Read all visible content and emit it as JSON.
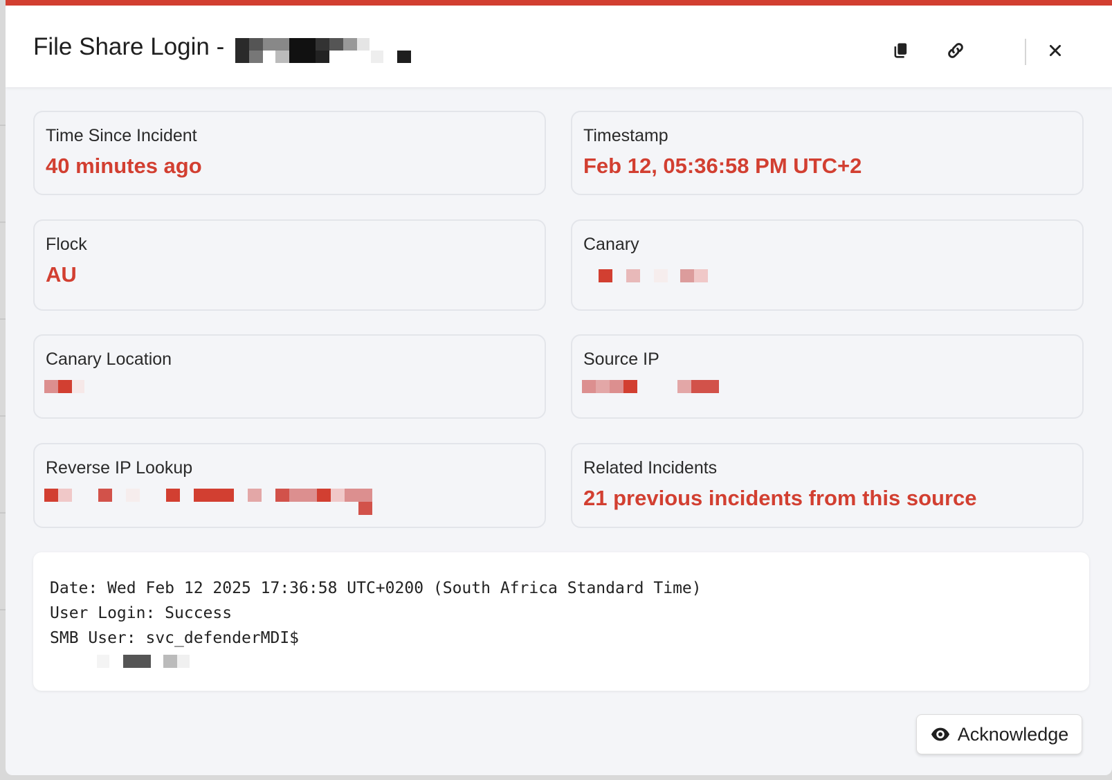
{
  "modal": {
    "title": "File Share Login -",
    "accent_color": "#d23f31",
    "header_icons": [
      "copy-icon",
      "link-icon",
      "close-icon"
    ]
  },
  "cards": {
    "time_since": {
      "label": "Time Since Incident",
      "value": "40 minutes ago"
    },
    "timestamp": {
      "label": "Timestamp",
      "value": "Feb 12, 05:36:58 PM UTC+2"
    },
    "flock": {
      "label": "Flock",
      "value": "AU"
    },
    "canary": {
      "label": "Canary"
    },
    "canary_location": {
      "label": "Canary Location"
    },
    "source_ip": {
      "label": "Source IP"
    },
    "reverse_ip": {
      "label": "Reverse IP Lookup"
    },
    "related": {
      "label": "Related Incidents",
      "value": "21 previous incidents from this source"
    }
  },
  "log": {
    "lines": [
      "Date: Wed Feb 12 2025 17:36:58 UTC+0200 (South Africa Standard Time)",
      "User Login: Success",
      "SMB User: svc_defenderMDI$"
    ]
  },
  "actions": {
    "acknowledge_label": "Acknowledge",
    "acknowledge_icon": "eye-icon"
  }
}
